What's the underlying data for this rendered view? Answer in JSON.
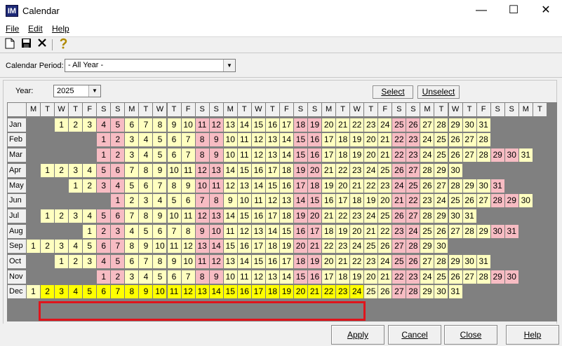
{
  "window": {
    "title": "Calendar",
    "app_icon": "IM"
  },
  "menu": [
    {
      "label": "File"
    },
    {
      "label": "Edit"
    },
    {
      "label": "Help"
    }
  ],
  "toolbar": {
    "icons": [
      "new-document-icon",
      "save-icon",
      "delete-icon",
      "help-icon"
    ]
  },
  "period": {
    "label": "Calendar Period:",
    "value": "- All Year -"
  },
  "year": {
    "label": "Year:",
    "value": "2025"
  },
  "buttons": {
    "select": "Select",
    "unselect": "Unselect",
    "apply": "Apply",
    "cancel": "Cancel",
    "close": "Close",
    "help": "Help"
  },
  "calendar": {
    "year": 2025,
    "day_headers": [
      "M",
      "T",
      "W",
      "T",
      "F",
      "S",
      "S",
      "M",
      "T",
      "W",
      "T",
      "F",
      "S",
      "S",
      "M",
      "T",
      "W",
      "T",
      "F",
      "S",
      "S",
      "M",
      "T",
      "W",
      "T",
      "F",
      "S",
      "S",
      "M",
      "T",
      "W",
      "T",
      "F",
      "S",
      "S",
      "M",
      "T"
    ],
    "months": [
      "Jan",
      "Feb",
      "Mar",
      "Apr",
      "May",
      "Jun",
      "Jul",
      "Aug",
      "Sep",
      "Oct",
      "Nov",
      "Dec"
    ],
    "selected": {
      "month": "Dec",
      "from_day": 2,
      "to_day": 24
    },
    "colors": {
      "weekday": "#ffffc0",
      "weekend": "#f7bcc3",
      "selected": "#ffff00",
      "empty": "#808080",
      "highlight_border": "#e0141c"
    }
  }
}
